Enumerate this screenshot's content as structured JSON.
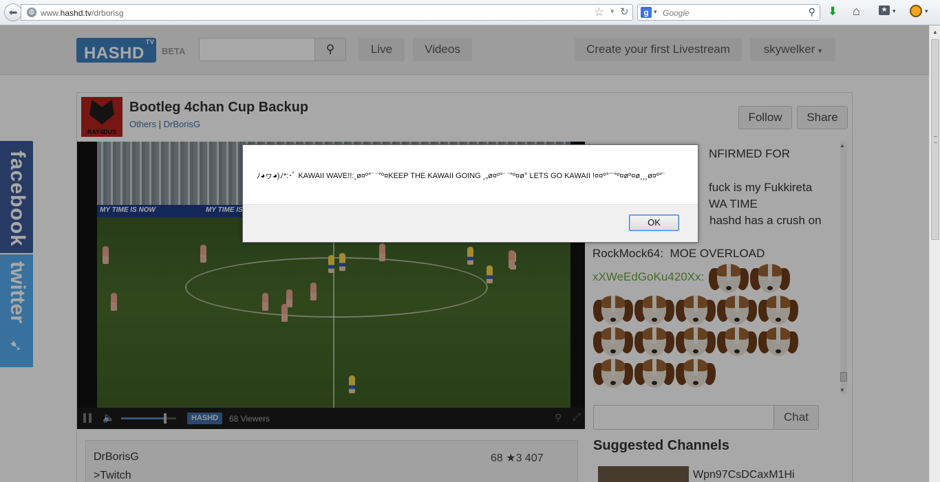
{
  "browser": {
    "url_prefix": "www.",
    "url_domain": "hashd.tv",
    "url_path": "/drborisg",
    "search_placeholder": "Google"
  },
  "header": {
    "logo": "HASHD",
    "logo_sup": "TV",
    "beta": "BETA",
    "nav_live": "Live",
    "nav_videos": "Videos",
    "nav_create": "Create your first Livestream",
    "nav_user": "skywelker"
  },
  "channel": {
    "avatar_tag": "RAY4DUS",
    "title": "Bootleg 4chan Cup Backup",
    "category": "Others",
    "separator": " | ",
    "owner": "DrBorisG",
    "follow": "Follow",
    "share": "Share"
  },
  "video": {
    "ad_text_1": "MY TIME IS NOW",
    "ad_text_2": "MY TIME IS",
    "volume_level": 0.8,
    "bar_logo": "HASHD",
    "viewers": "68 Viewers"
  },
  "info": {
    "name": "DrBorisG",
    "stats": "68 ★3 407",
    "link": ">Twitch"
  },
  "chat": {
    "line1_user": "",
    "line1_text": "NFIRMED FOR",
    "line2_text": "fuck is my Fukkireta",
    "line3_text": "WA TIME",
    "line4_text": "hashd has a crush on",
    "line5_user": "RockMock64:",
    "line5_text": "MOE OVERLOAD",
    "line6_user": "xXWeEdGoKu420Xx:",
    "input_placeholder": "",
    "send_button": "Chat"
  },
  "suggested": {
    "title": "Suggested Channels",
    "item1": "Wpn97CsDCaxM1Hi"
  },
  "social": {
    "facebook": "facebook",
    "twitter": "twitter"
  },
  "dialog": {
    "message": "ﾉ◕ヮ◕)ﾉ*:･ﾟ KAWAII WAVE!!:¸ø¤º°¨ ¨°º¤KEEP THE KAWAII GOING ¸„ø¤º°¨ ¨°º¤ø° LETS GO KAWAII !¤¤º°¨¨°º¤øº¤ø¸¸¸ø¤º°¨",
    "ok_button": "OK"
  },
  "colors": {
    "brand": "#3d7fbe",
    "facebook": "#3b5998",
    "twitter": "#55acee",
    "chat_user_green": "#6ca243"
  }
}
